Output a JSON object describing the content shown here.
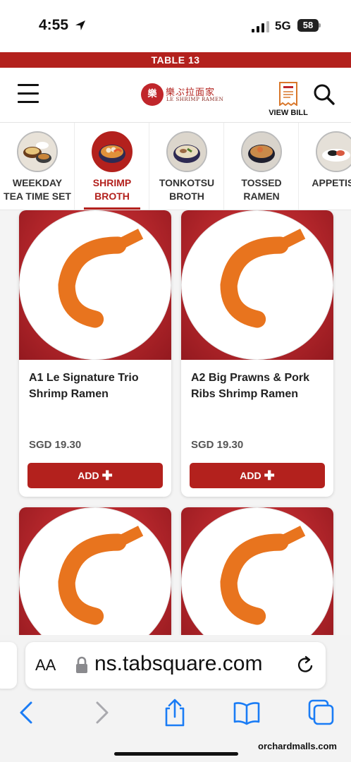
{
  "status_bar": {
    "time": "4:55",
    "network": "5G",
    "battery": "58"
  },
  "banner": {
    "table_label": "TABLE 13"
  },
  "header": {
    "logo_cn": "樂ぷ拉面家",
    "logo_en": "LE SHRIMP RAMEN",
    "logo_mark": "樂",
    "bill_label": "VIEW BILL",
    "icons": [
      "menu-icon",
      "bill-icon",
      "search-icon"
    ]
  },
  "categories": [
    {
      "label": "WEEKDAY TEA TIME SET",
      "line1": "WEEKDAY",
      "line2": "TEA TIME SET",
      "active": false
    },
    {
      "label": "SHRIMP BROTH",
      "line1": "SHRIMP",
      "line2": "BROTH",
      "active": true
    },
    {
      "label": "TONKOTSU BROTH",
      "line1": "TONKOTSU",
      "line2": "BROTH",
      "active": false
    },
    {
      "label": "TOSSED RAMEN",
      "line1": "TOSSED",
      "line2": "RAMEN",
      "active": false
    },
    {
      "label": "APPETISE",
      "line1": "APPETISE",
      "line2": "",
      "active": false
    }
  ],
  "products": [
    {
      "name": "A1 Le Signature Trio Shrimp Ramen",
      "price": "SGD 19.30",
      "button": "ADD"
    },
    {
      "name": "A2 Big Prawns & Pork Ribs Shrimp Ramen",
      "price": "SGD 19.30",
      "button": "ADD"
    },
    {
      "name": "",
      "price": "",
      "button": ""
    },
    {
      "name": "",
      "price": "",
      "button": ""
    }
  ],
  "browser": {
    "aa_label": "AA",
    "url": "ns.tabsquare.com",
    "icons": [
      "back-icon",
      "forward-icon",
      "share-icon",
      "bookmarks-icon",
      "tabs-icon",
      "reload-icon",
      "lock-icon"
    ]
  },
  "watermark": "orchardmalls.com",
  "colors": {
    "brand_red": "#b3211d",
    "text_dark": "#222222",
    "ios_blue": "#1a7cf5"
  }
}
